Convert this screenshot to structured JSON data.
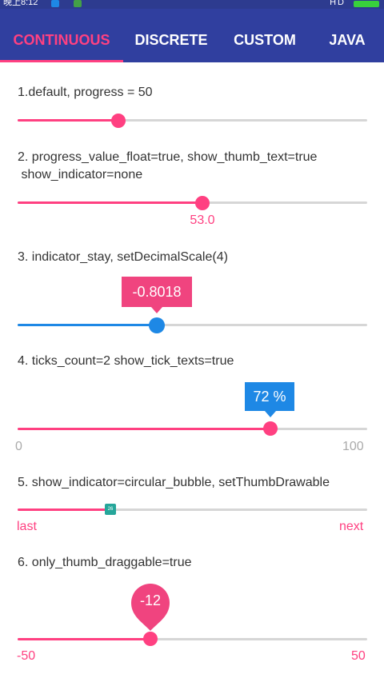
{
  "status_bar": {
    "time": "晚上8:12",
    "network": "HD"
  },
  "tabs": [
    {
      "label": "CONTINUOUS",
      "active": true
    },
    {
      "label": "DISCRETE",
      "active": false
    },
    {
      "label": "CUSTOM",
      "active": false
    },
    {
      "label": "JAVA",
      "active": false
    }
  ],
  "colors": {
    "app_bar": "#303f9f",
    "accent": "#ff4081",
    "blue": "#1e88e5",
    "track": "#d6d6d6",
    "thumb_teal": "#26a69a"
  },
  "seekbars": [
    {
      "label": "1.default, progress = 50",
      "progress_fraction": 0.29
    },
    {
      "label_line1": "2. progress_value_float=true, show_thumb_text=true",
      "label_line2": " show_indicator=none",
      "thumb_text": "53.0",
      "progress_fraction": 0.53
    },
    {
      "label": "3. indicator_stay, setDecimalScale(4)",
      "indicator_text": "-0.8018",
      "progress_fraction": 0.4
    },
    {
      "label": "4. ticks_count=2 show_tick_texts=true",
      "indicator_text": "72 %",
      "tick_start": "0",
      "tick_end": "100",
      "progress_fraction": 0.72
    },
    {
      "label": "5. show_indicator=circular_bubble, setThumbDrawable",
      "thumb_icon_text": "26",
      "tick_start": "last",
      "tick_end": "next",
      "progress_fraction": 0.27
    },
    {
      "label": "6. only_thumb_draggable=true",
      "indicator_text": "-12",
      "tick_start": "-50",
      "tick_end": "50",
      "progress_fraction": 0.38
    }
  ]
}
